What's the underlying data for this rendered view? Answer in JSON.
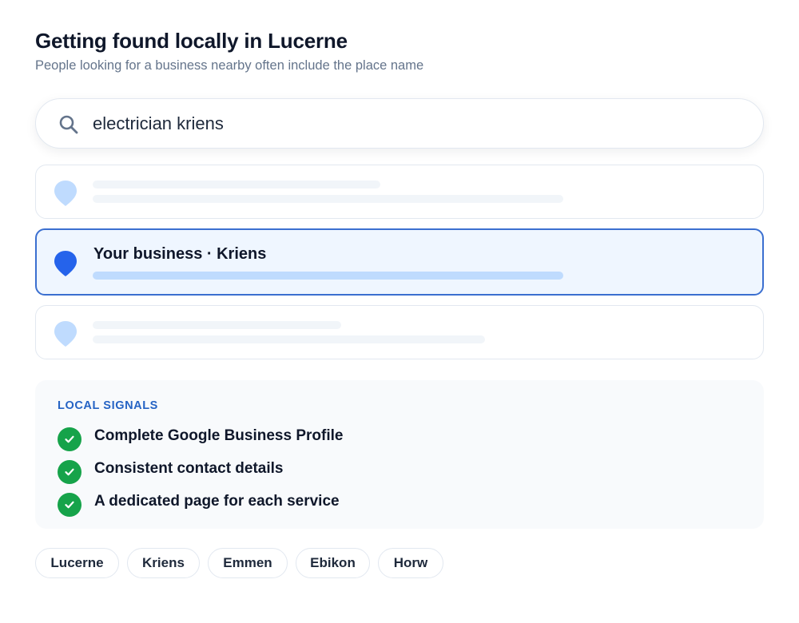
{
  "header": {
    "title": "Getting found locally in Lucerne",
    "subtitle": "People looking for a business nearby often include the place name"
  },
  "search": {
    "query": "electrician kriens",
    "icon": "search-icon"
  },
  "results": [
    {
      "type": "placeholder",
      "highlighted": false
    },
    {
      "type": "business",
      "highlighted": true,
      "label": "Your business · Kriens"
    },
    {
      "type": "placeholder",
      "highlighted": false
    }
  ],
  "signals": {
    "heading": "LOCAL SIGNALS",
    "items": [
      "Complete Google Business Profile",
      "Consistent contact details",
      "A dedicated page for each service"
    ]
  },
  "places": [
    "Lucerne",
    "Kriens",
    "Emmen",
    "Ebikon",
    "Horw"
  ],
  "colors": {
    "accent": "#2563eb",
    "highlight_border": "#3b6fd0",
    "highlight_bg": "#eff6ff",
    "pin_muted": "#bfdbfe",
    "check": "#16a34a",
    "heading": "#2563c4"
  }
}
